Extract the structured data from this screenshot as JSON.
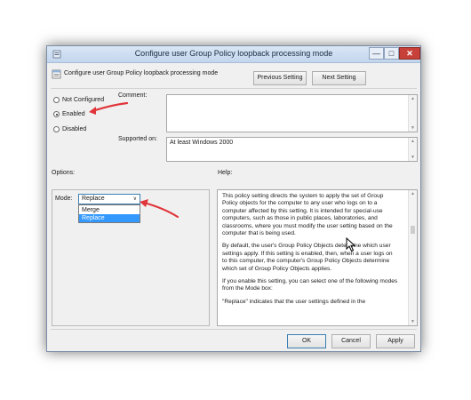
{
  "window": {
    "title": "Configure user Group Policy loopback processing mode",
    "controls": {
      "minimize": "—",
      "maximize": "□",
      "close": "✕"
    }
  },
  "header": {
    "setting_name": "Configure user Group Policy loopback processing mode",
    "previous_label": "Previous Setting",
    "next_label": "Next Setting"
  },
  "state": {
    "options": [
      {
        "label": "Not Configured",
        "selected": false
      },
      {
        "label": "Enabled",
        "selected": true
      },
      {
        "label": "Disabled",
        "selected": false
      }
    ]
  },
  "comment": {
    "label": "Comment:",
    "value": ""
  },
  "supported": {
    "label": "Supported on:",
    "value": "At least Windows 2000"
  },
  "options_section": {
    "label": "Options:",
    "mode_label": "Mode:",
    "mode_value": "Replace",
    "dropdown_items": [
      {
        "label": "Merge",
        "highlighted": false
      },
      {
        "label": "Replace",
        "highlighted": true
      }
    ]
  },
  "help": {
    "label": "Help:",
    "paragraphs": [
      "This policy setting directs the system to apply the set of Group Policy objects for the computer to any user who logs on to a computer affected by this setting. It is intended for special-use computers, such as those in public places, laboratories, and classrooms, where you must modify the user setting based on the computer that is being used.",
      "By default, the user's Group Policy Objects determine which user settings apply. If this setting is enabled, then, when a user logs on to this computer, the computer's Group Policy Objects determine which set of Group Policy Objects applies.",
      "If you enable this setting, you can select one of the following modes from the Mode box:",
      "\"Replace\" indicates that the user settings defined in the"
    ]
  },
  "footer": {
    "ok_label": "OK",
    "cancel_label": "Cancel",
    "apply_label": "Apply"
  },
  "colors": {
    "annotation_arrow": "#e0353a",
    "selection": "#3399ff",
    "close_button": "#c7413a"
  },
  "icons": [
    "policy-icon",
    "settings-page-icon",
    "mouse-cursor-icon"
  ]
}
